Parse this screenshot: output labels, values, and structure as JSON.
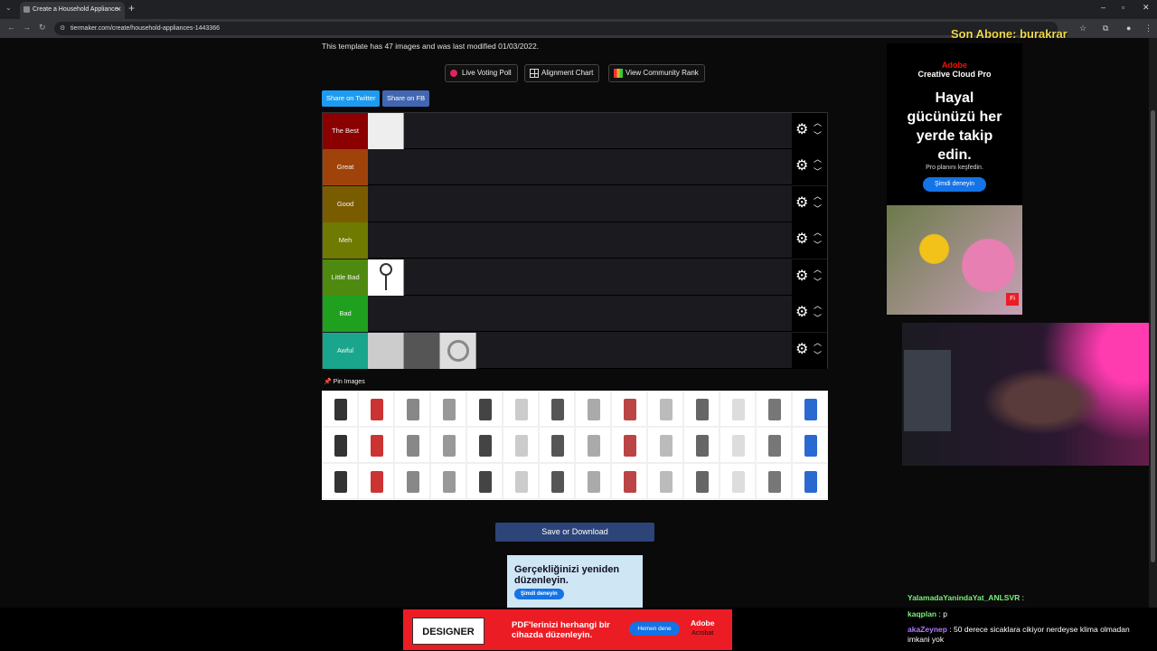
{
  "browser": {
    "tab_title": "Create a Household Appliance",
    "url": "tiermaker.com/create/household-appliances-1443366",
    "new_tab_glyph": "+",
    "close_glyph": "×"
  },
  "page": {
    "info": "This template has 47 images and was last modified 01/03/2022.",
    "buttons": {
      "live_voting": "Live Voting Poll",
      "alignment_chart": "Alignment Chart",
      "community_rank": "View Community Rank",
      "share_twitter": "Share on Twitter",
      "share_fb": "Share on FB",
      "save_download": "Save or Download"
    },
    "tiers": [
      {
        "label": "The Best",
        "color": "#8b0000",
        "items": 1
      },
      {
        "label": "Great",
        "color": "#a0430a",
        "items": 0
      },
      {
        "label": "Good",
        "color": "#7a5c00",
        "items": 0
      },
      {
        "label": "Meh",
        "color": "#6e7a00",
        "items": 0
      },
      {
        "label": "Little Bad",
        "color": "#4f8a10",
        "items": 1
      },
      {
        "label": "Bad",
        "color": "#1fa01f",
        "items": 0
      },
      {
        "label": "Awful",
        "color": "#1aa68c",
        "items": 3
      }
    ],
    "pin_images": "Pin Images",
    "pool_count": 42
  },
  "ads": {
    "right": {
      "brand_line1": "Adobe",
      "brand_line2": "Creative Cloud Pro",
      "headline": "Hayal gücünüzü her yerde takip edin.",
      "sub": "Pro planını keşfedin.",
      "cta": "Şimdi deneyin"
    },
    "center": {
      "headline": "Gerçekliğinizi yeniden düzenleyin.",
      "cta": "Şimdi deneyin"
    },
    "bottom": {
      "logo": "DESIGNER",
      "text": "PDF'lerinizi herhangi bir cihazda düzenleyin.",
      "cta": "Hemen dene",
      "brand1": "Adobe",
      "brand2": "Acrobat"
    }
  },
  "stream": {
    "overlay": "Son Abone: burakrar",
    "chat": [
      {
        "user": "YalamadaYanindaYat_ANLSVR",
        "msg": ""
      },
      {
        "user": "kaqplan",
        "msg": "p"
      },
      {
        "user": "akaZeynep",
        "msg": "50 derece sicaklara cikiyor nerdeyse klima olmadan imkani yok"
      }
    ]
  }
}
